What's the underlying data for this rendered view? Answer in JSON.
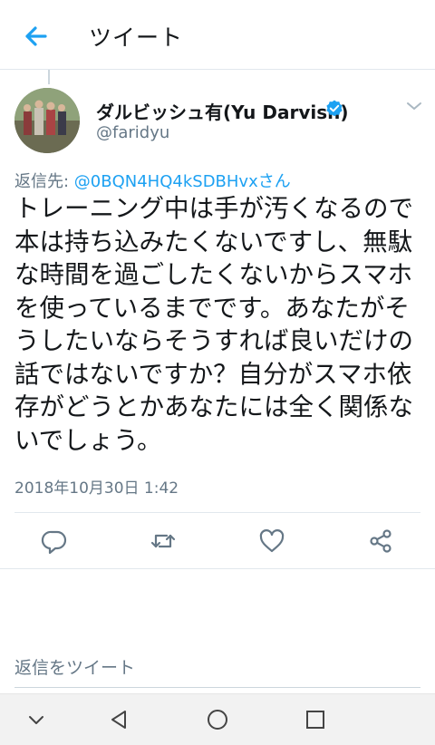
{
  "header": {
    "title": "ツイート"
  },
  "tweet": {
    "display_name": "ダルビッシュ有(Yu Darvish)",
    "handle": "@faridyu",
    "reply_prefix": "返信先: ",
    "reply_mention": "@0BQN4HQ4kSDBHvxさん",
    "text": "トレーニング中は手が汚くなるので本は持ち込みたくないですし、無駄な時間を過ごしたくないからスマホを使っているまでです。あなたがそうしたいならそうすれば良いだけの話ではないですか？自分がスマホ依存がどうとかあなたには全く関係ないでしょう。",
    "timestamp": "2018年10月30日 1:42"
  },
  "reply_box": {
    "placeholder": "返信をツイート"
  },
  "colors": {
    "accent": "#1da1f2",
    "icon_gray": "#657786",
    "text": "#14171a",
    "divider": "#e1e8ed",
    "navbar": "#f2f2f2"
  },
  "icons": {
    "back": "arrow-left-icon",
    "verified": "verified-badge-icon",
    "caret": "chevron-down-icon",
    "reply": "reply-icon",
    "retweet": "retweet-icon",
    "like": "heart-icon",
    "share": "share-icon",
    "nav_down": "chevron-down-icon",
    "nav_back": "triangle-back-icon",
    "nav_home": "circle-home-icon",
    "nav_recents": "square-recents-icon"
  }
}
